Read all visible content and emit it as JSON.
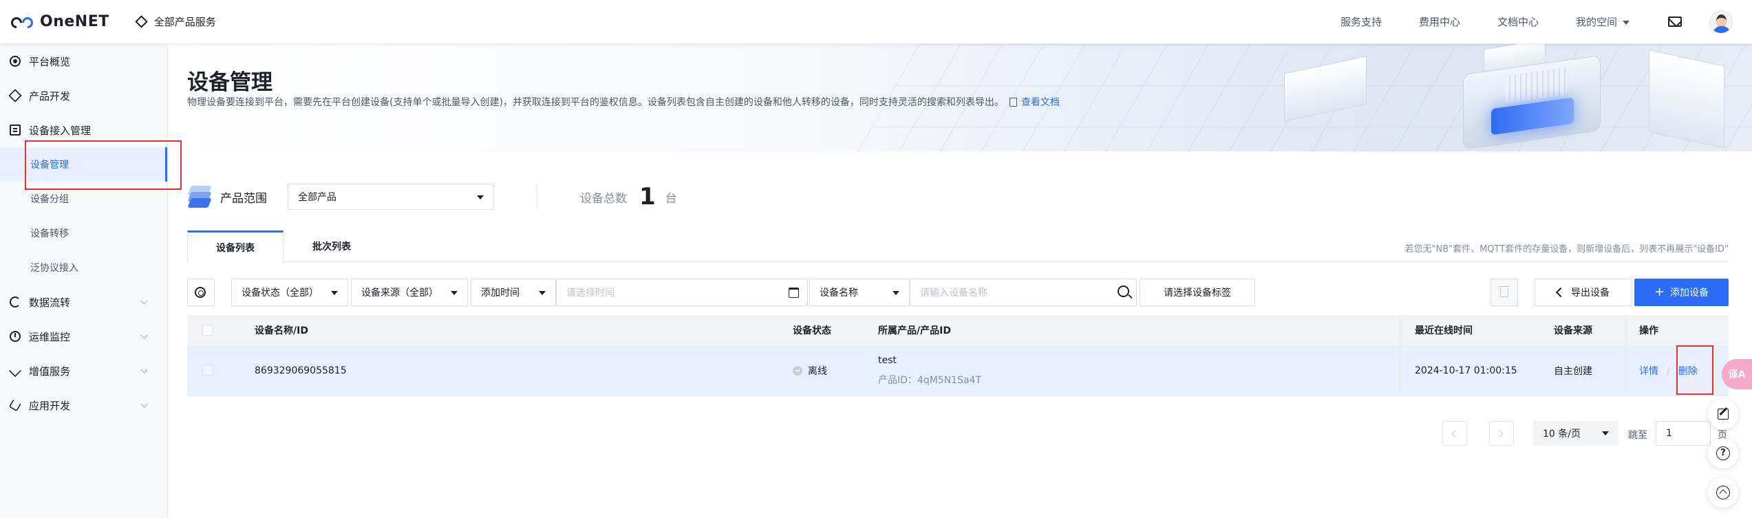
{
  "header": {
    "logo_text": "OneNET",
    "all_products": "全部产品服务",
    "links": [
      "服务支持",
      "费用中心",
      "文档中心",
      "我的空间"
    ]
  },
  "sidebar": {
    "items": [
      {
        "label": "平台概览",
        "icon": "overview-icon"
      },
      {
        "label": "产品开发",
        "icon": "product-dev-icon"
      },
      {
        "label": "设备接入管理",
        "icon": "device-access-icon",
        "expanded": true,
        "children": [
          "设备管理",
          "设备分组",
          "设备转移",
          "泛协议接入"
        ]
      },
      {
        "label": "数据流转",
        "icon": "data-flow-icon"
      },
      {
        "label": "运维监控",
        "icon": "monitor-icon"
      },
      {
        "label": "增值服务",
        "icon": "value-added-icon"
      },
      {
        "label": "应用开发",
        "icon": "app-dev-icon"
      }
    ],
    "active_child": "设备管理"
  },
  "banner": {
    "title": "设备管理",
    "description": "物理设备要连接到平台，需要先在平台创建设备(支持单个或批量导入创建)，并获取连接到平台的鉴权信息。设备列表包含自主创建的设备和他人转移的设备，同时支持灵活的搜索和列表导出。",
    "doc_link": "查看文档"
  },
  "range": {
    "label": "产品范围",
    "selected": "全部产品",
    "total_label": "设备总数",
    "total_value": "1",
    "total_unit": "台"
  },
  "tabs": {
    "items": [
      "设备列表",
      "批次列表"
    ],
    "active": "设备列表",
    "note": "若您无\"NB\"套件、MQTT套件的存量设备，则新增设备后，列表不再展示\"设备ID\""
  },
  "filters": {
    "status": "设备状态（全部）",
    "source": "设备来源（全部）",
    "time_field": "添加时间",
    "time_placeholder": "请选择时间",
    "name_field": "设备名称",
    "name_placeholder": "请输入设备名称",
    "tag_button": "请选择设备标签",
    "export_button": "导出设备",
    "add_button": "添加设备"
  },
  "table": {
    "columns": [
      "设备名称/ID",
      "设备状态",
      "所属产品/产品ID",
      "最近在线时间",
      "设备来源",
      "操作"
    ],
    "rows": [
      {
        "name": "869329069055815",
        "status": "离线",
        "product": "test",
        "product_id": "产品ID：4qM5N1Sa4T",
        "last_online": "2024-10-17 01:00:15",
        "source": "自主创建",
        "actions": [
          "详情",
          "删除"
        ],
        "action_sep": "/"
      }
    ]
  },
  "pagination": {
    "page_size": "10 条/页",
    "jump_label": "跳至",
    "jump_value": "1",
    "jump_suffix": "页"
  },
  "floating": {
    "translate_label": "译A"
  },
  "colors": {
    "primary": "#2a6cf6",
    "highlight_row": "#e8effe",
    "annotation_red": "#e3312e"
  }
}
